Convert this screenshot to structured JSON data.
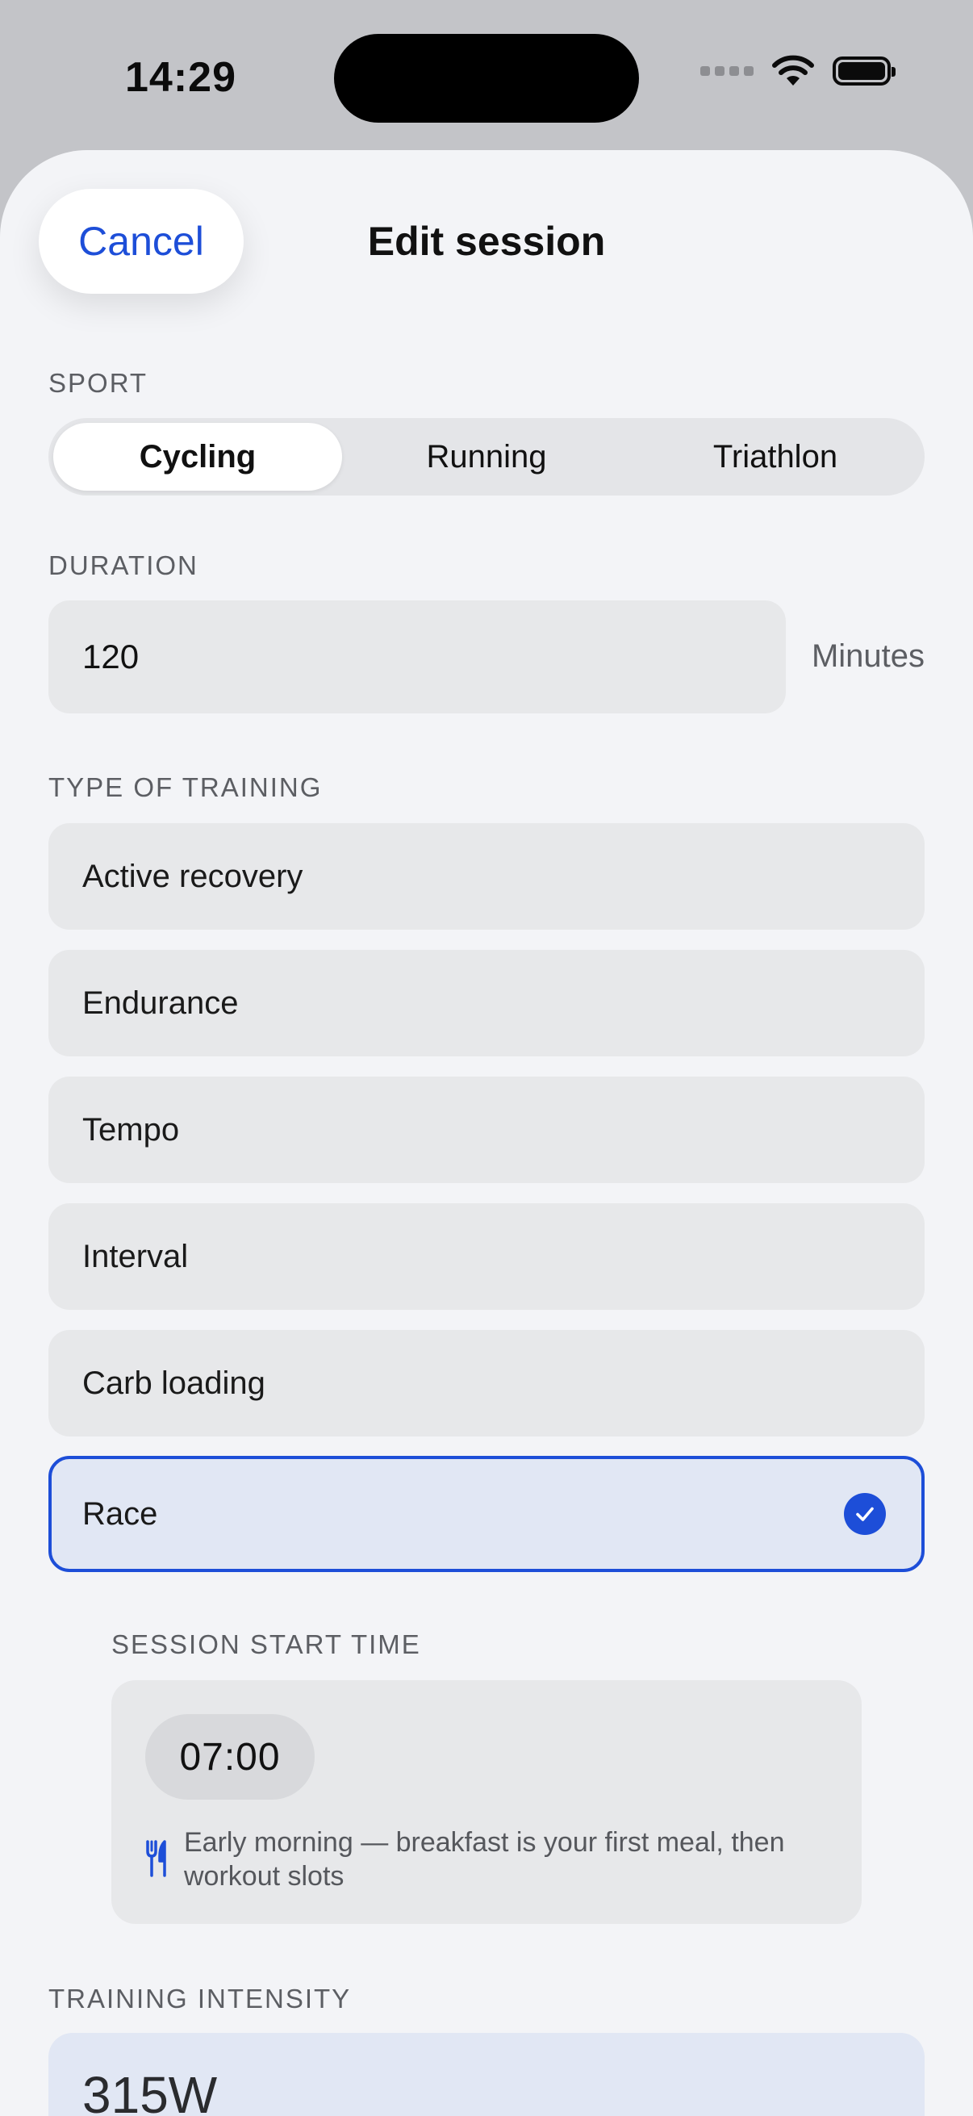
{
  "status_bar": {
    "time": "14:29"
  },
  "header": {
    "cancel_label": "Cancel",
    "title": "Edit session"
  },
  "sport": {
    "label": "SPORT",
    "options": [
      "Cycling",
      "Running",
      "Triathlon"
    ],
    "selected": "Cycling"
  },
  "duration": {
    "label": "DURATION",
    "value": "120",
    "unit": "Minutes"
  },
  "training_type": {
    "label": "TYPE OF TRAINING",
    "options": [
      "Active recovery",
      "Endurance",
      "Tempo",
      "Interval",
      "Carb loading",
      "Race"
    ],
    "selected": "Race"
  },
  "session_start": {
    "label": "SESSION START TIME",
    "time": "07:00",
    "note": "Early morning — breakfast is your first meal, then workout slots"
  },
  "intensity": {
    "label": "TRAINING INTENSITY",
    "value": "315W"
  },
  "colors": {
    "accent": "#1d4ed8",
    "selected_bg": "#e1e7f4",
    "field_bg": "#e7e8ea"
  }
}
